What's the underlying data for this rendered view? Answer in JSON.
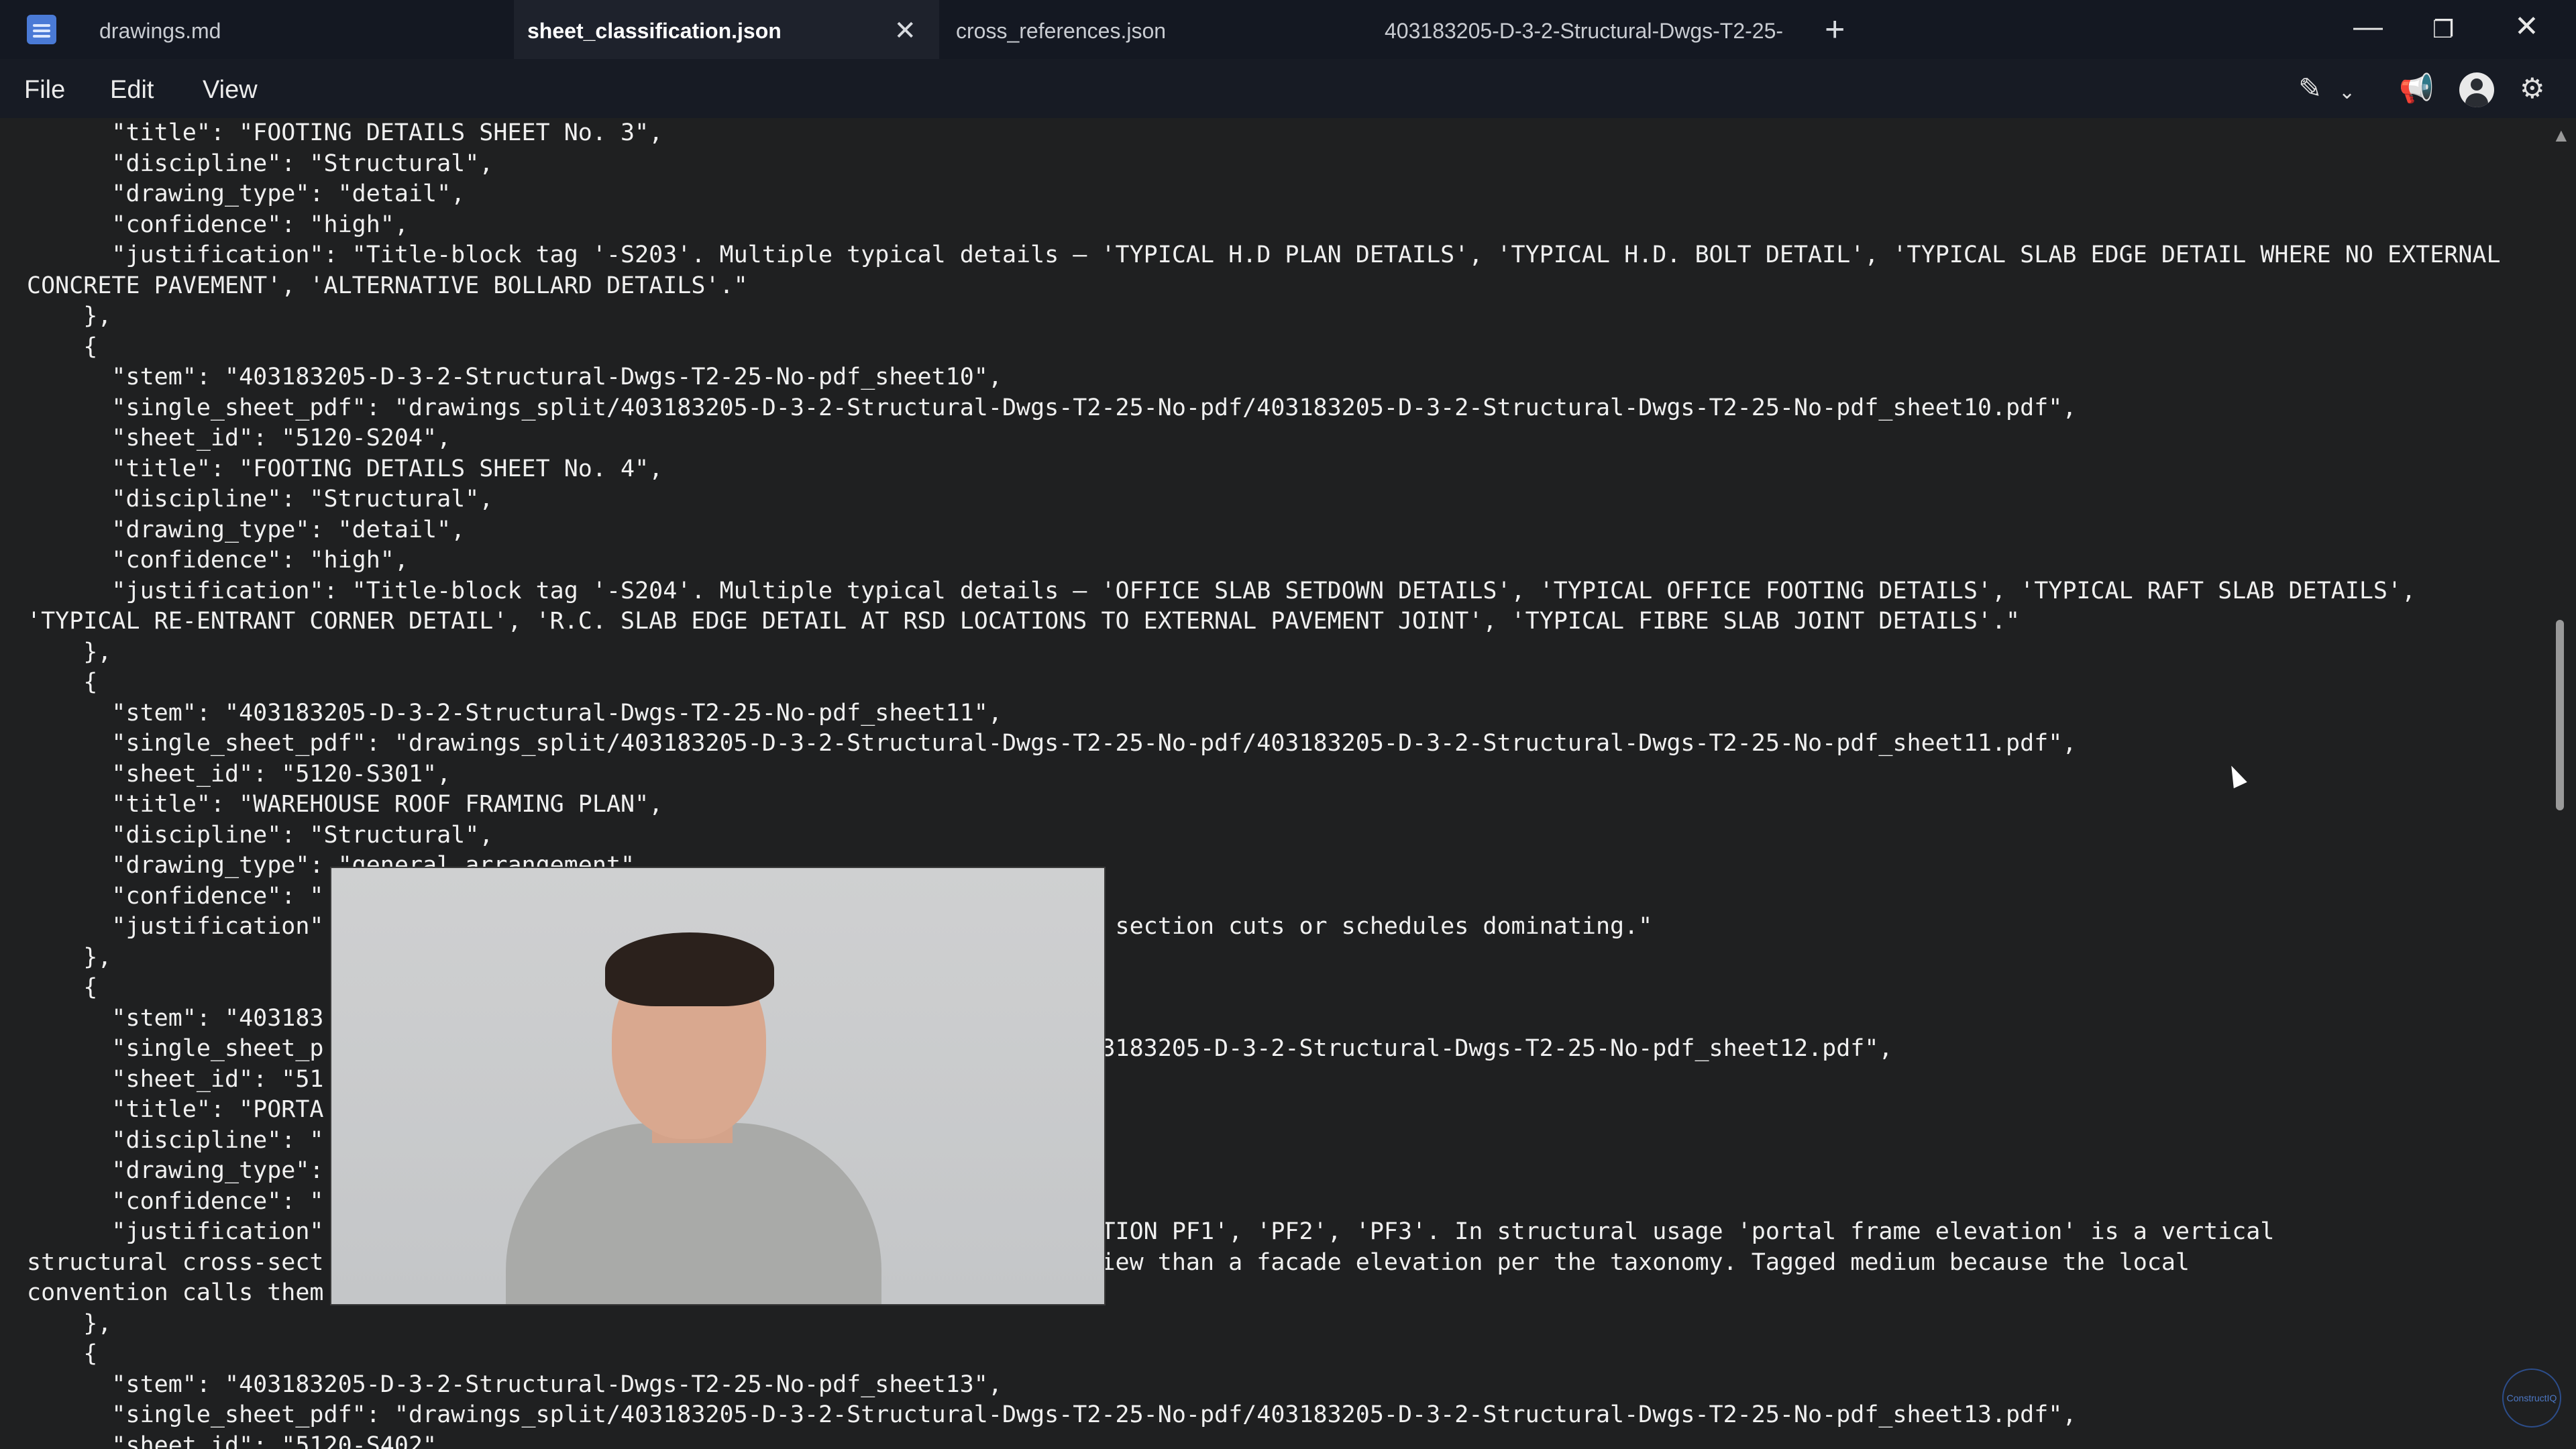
{
  "tabs": [
    {
      "label": "drawings.md",
      "active": false
    },
    {
      "label": "sheet_classification.json",
      "active": true
    },
    {
      "label": "cross_references.json",
      "active": false
    },
    {
      "label": "403183205-D-3-2-Structural-Dwgs-T2-25-",
      "active": false
    }
  ],
  "menu": {
    "file": "File",
    "edit": "Edit",
    "view": "View"
  },
  "watermark": "ConstructIQ",
  "editor": {
    "lines": [
      "      \"title\": \"FOOTING DETAILS SHEET No. 3\",",
      "      \"discipline\": \"Structural\",",
      "      \"drawing_type\": \"detail\",",
      "      \"confidence\": \"high\",",
      "      \"justification\": \"Title-block tag '-S203'. Multiple typical details — 'TYPICAL H.D PLAN DETAILS', 'TYPICAL H.D. BOLT DETAIL', 'TYPICAL SLAB EDGE DETAIL WHERE NO EXTERNAL",
      "CONCRETE PAVEMENT', 'ALTERNATIVE BOLLARD DETAILS'.\"",
      "    },",
      "    {",
      "      \"stem\": \"403183205-D-3-2-Structural-Dwgs-T2-25-No-pdf_sheet10\",",
      "      \"single_sheet_pdf\": \"drawings_split/403183205-D-3-2-Structural-Dwgs-T2-25-No-pdf/403183205-D-3-2-Structural-Dwgs-T2-25-No-pdf_sheet10.pdf\",",
      "      \"sheet_id\": \"5120-S204\",",
      "      \"title\": \"FOOTING DETAILS SHEET No. 4\",",
      "      \"discipline\": \"Structural\",",
      "      \"drawing_type\": \"detail\",",
      "      \"confidence\": \"high\",",
      "      \"justification\": \"Title-block tag '-S204'. Multiple typical details — 'OFFICE SLAB SETDOWN DETAILS', 'TYPICAL OFFICE FOOTING DETAILS', 'TYPICAL RAFT SLAB DETAILS',",
      "'TYPICAL RE-ENTRANT CORNER DETAIL', 'R.C. SLAB EDGE DETAIL AT RSD LOCATIONS TO EXTERNAL PAVEMENT JOINT', 'TYPICAL FIBRE SLAB JOINT DETAILS'.\"",
      "    },",
      "    {",
      "      \"stem\": \"403183205-D-3-2-Structural-Dwgs-T2-25-No-pdf_sheet11\",",
      "      \"single_sheet_pdf\": \"drawings_split/403183205-D-3-2-Structural-Dwgs-T2-25-No-pdf/403183205-D-3-2-Structural-Dwgs-T2-25-No-pdf_sheet11.pdf\",",
      "      \"sheet_id\": \"5120-S301\",",
      "      \"title\": \"WAREHOUSE ROOF FRAMING PLAN\",",
      "      \"discipline\": \"Structural\",",
      "      \"drawing_type\": \"general_arrangement\",",
      "      \"confidence\": \"",
      "      \"justification\"                                         aming plan. No section cuts or schedules dominating.\"",
      "    },",
      "    {",
      "      \"stem\": \"403183",
      "      \"single_sheet_p                                         2-25-No-pdf/403183205-D-3-2-Structural-Dwgs-T2-25-No-pdf_sheet12.pdf\",",
      "      \"sheet_id\": \"51",
      "      \"title\": \"PORTA",
      "      \"discipline\": \"",
      "      \"drawing_type\":",
      "      \"confidence\": \"",
      "      \"justification\"                                         AL FRAME ELEVATION PF1', 'PF2', 'PF3'. In structural usage 'portal frame elevation' is a vertical",
      "structural cross-sect                                         to a section_view than a facade elevation per the taxonomy. Tagged medium because the local",
      "convention calls them",
      "    },",
      "    {",
      "      \"stem\": \"403183205-D-3-2-Structural-Dwgs-T2-25-No-pdf_sheet13\",",
      "      \"single_sheet_pdf\": \"drawings_split/403183205-D-3-2-Structural-Dwgs-T2-25-No-pdf/403183205-D-3-2-Structural-Dwgs-T2-25-No-pdf_sheet13.pdf\",",
      "      \"sheet_id\": \"5120-S402\","
    ]
  }
}
